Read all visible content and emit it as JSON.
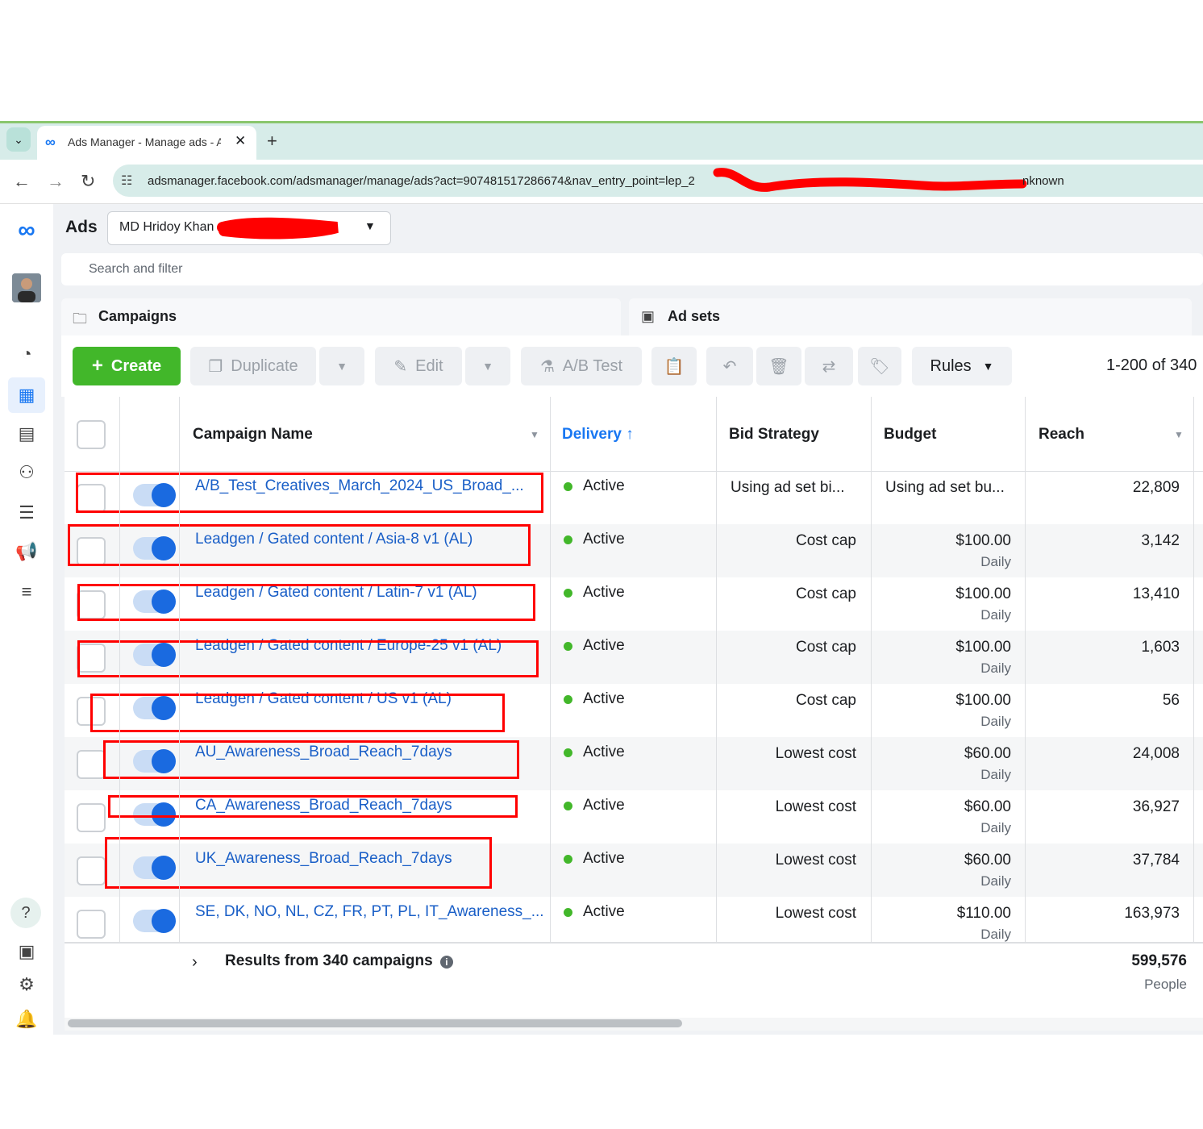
{
  "browser": {
    "tab_title": "Ads Manager - Manage ads - A",
    "tab_close": "✕",
    "new_tab": "+",
    "url": "adsmanager.facebook.com/adsmanager/manage/ads?act=907481517286674&nav_entry_point=lep_2",
    "url_tail": "nknown"
  },
  "header": {
    "app_label": "Ads",
    "account_name": "MD Hridoy Khan",
    "search_placeholder": "Search and filter"
  },
  "level_tabs": [
    {
      "label": "Campaigns"
    },
    {
      "label": "Ad sets"
    }
  ],
  "toolbar": {
    "create": "Create",
    "duplicate": "Duplicate",
    "edit": "Edit",
    "ab_test": "A/B Test",
    "rules": "Rules",
    "pager": "1-200 of 340"
  },
  "table": {
    "headers": {
      "name": "Campaign Name",
      "delivery": "Delivery",
      "bid": "Bid Strategy",
      "budget": "Budget",
      "reach": "Reach"
    },
    "rows": [
      {
        "name": "A/B_Test_Creatives_March_2024_US_Broad_...",
        "delivery": "Active",
        "bid": "Using ad set bi...",
        "budget": "Using ad set bu...",
        "budget_period": "",
        "reach": "22,809"
      },
      {
        "name": "Leadgen / Gated content / Asia-8 v1 (AL)",
        "delivery": "Active",
        "bid": "Cost cap",
        "budget": "$100.00",
        "budget_period": "Daily",
        "reach": "3,142"
      },
      {
        "name": "Leadgen / Gated content / Latin-7 v1 (AL)",
        "delivery": "Active",
        "bid": "Cost cap",
        "budget": "$100.00",
        "budget_period": "Daily",
        "reach": "13,410"
      },
      {
        "name": "Leadgen / Gated content / Europe-25 v1 (AL)",
        "delivery": "Active",
        "bid": "Cost cap",
        "budget": "$100.00",
        "budget_period": "Daily",
        "reach": "1,603"
      },
      {
        "name": "Leadgen / Gated content / US v1 (AL)",
        "delivery": "Active",
        "bid": "Cost cap",
        "budget": "$100.00",
        "budget_period": "Daily",
        "reach": "56"
      },
      {
        "name": "AU_Awareness_Broad_Reach_7days",
        "delivery": "Active",
        "bid": "Lowest cost",
        "budget": "$60.00",
        "budget_period": "Daily",
        "reach": "24,008"
      },
      {
        "name": "CA_Awareness_Broad_Reach_7days",
        "delivery": "Active",
        "bid": "Lowest cost",
        "budget": "$60.00",
        "budget_period": "Daily",
        "reach": "36,927"
      },
      {
        "name": "UK_Awareness_Broad_Reach_7days",
        "delivery": "Active",
        "bid": "Lowest cost",
        "budget": "$60.00",
        "budget_period": "Daily",
        "reach": "37,784"
      },
      {
        "name": "SE, DK, NO, NL, CZ, FR, PT, PL, IT_Awareness_...",
        "delivery": "Active",
        "bid": "Lowest cost",
        "budget": "$110.00",
        "budget_period": "Daily",
        "reach": "163,973"
      }
    ],
    "summary": {
      "label": "Results from 340 campaigns",
      "reach_total": "599,576",
      "reach_unit": "People"
    }
  },
  "colors": {
    "accent": "#1877f2",
    "create_green": "#42b72a",
    "annotation_red": "#ff0000"
  }
}
